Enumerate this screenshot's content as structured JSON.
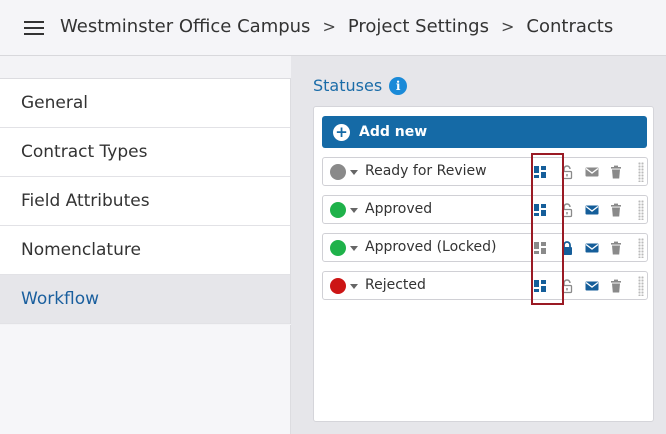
{
  "header": {
    "breadcrumb": [
      "Westminster Office Campus",
      "Project Settings",
      "Contracts"
    ],
    "separator": ">"
  },
  "sidebar": {
    "items": [
      {
        "label": "General",
        "active": false
      },
      {
        "label": "Contract Types",
        "active": false
      },
      {
        "label": "Field Attributes",
        "active": false
      },
      {
        "label": "Nomenclature",
        "active": false
      },
      {
        "label": "Workflow",
        "active": true
      }
    ]
  },
  "main": {
    "title": "Statuses",
    "info_glyph": "i",
    "add_button": {
      "label": "Add new",
      "glyph": "+"
    },
    "statuses": [
      {
        "name": "Ready for Review",
        "color": "#8a8a8a",
        "layout_active": true,
        "locked": false,
        "email_active": false
      },
      {
        "name": "Approved",
        "color": "#1fb24a",
        "layout_active": true,
        "locked": false,
        "email_active": true
      },
      {
        "name": "Approved (Locked)",
        "color": "#1fb24a",
        "layout_active": false,
        "locked": true,
        "email_active": true
      },
      {
        "name": "Rejected",
        "color": "#cc1515",
        "layout_active": true,
        "locked": false,
        "email_active": true
      }
    ]
  },
  "colors": {
    "accent": "#156aa6",
    "icon_inactive": "#8a8a8a",
    "icon_active": "#155e9a",
    "highlight": "#9a1a24"
  }
}
